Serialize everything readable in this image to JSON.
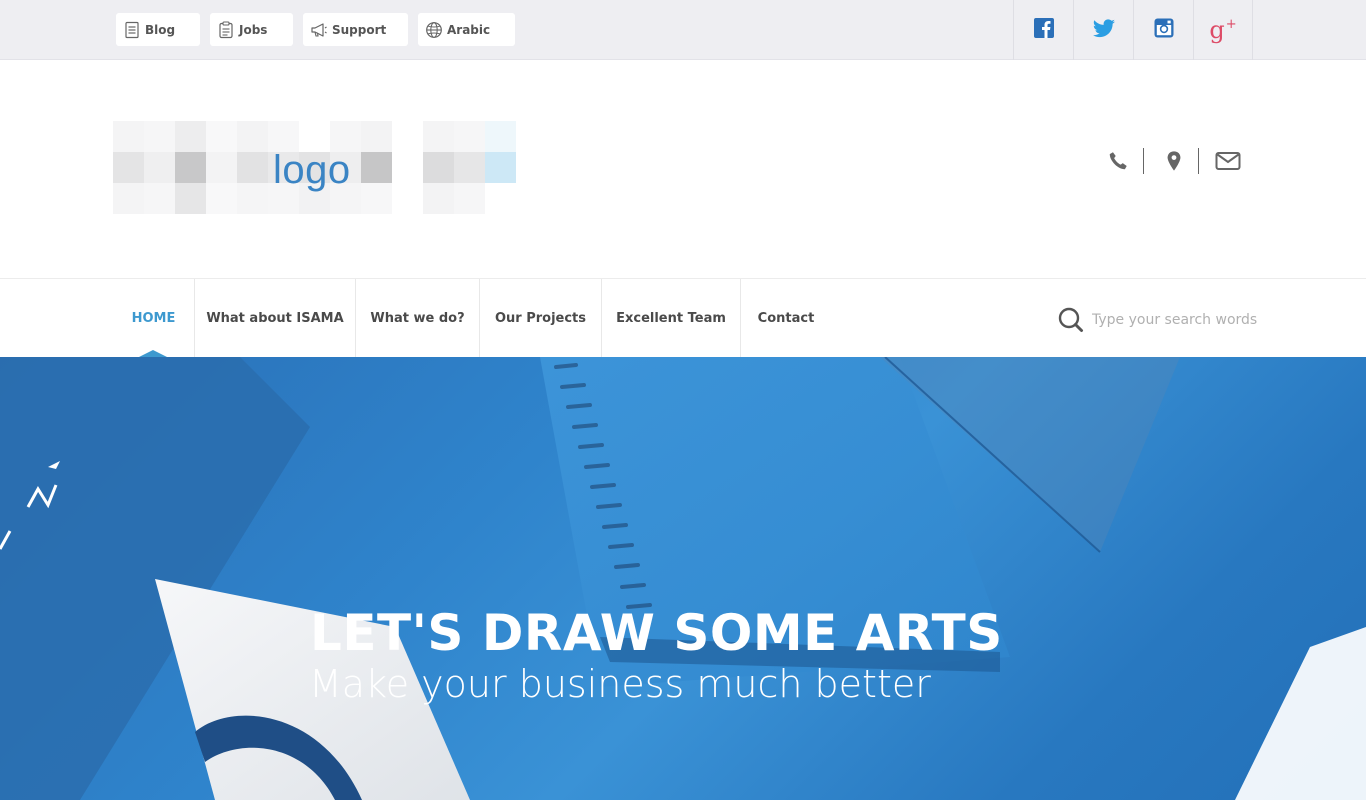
{
  "topbar": {
    "links": [
      {
        "label": "Blog",
        "icon": "document-icon"
      },
      {
        "label": "Jobs",
        "icon": "clipboard-icon"
      },
      {
        "label": "Support",
        "icon": "megaphone-icon"
      },
      {
        "label": "Arabic",
        "icon": "globe-icon"
      }
    ],
    "social": [
      {
        "name": "facebook-icon",
        "color": "#2b6fb8"
      },
      {
        "name": "twitter-icon",
        "color": "#2b9ee3"
      },
      {
        "name": "instagram-icon",
        "color": "#2b6fb8"
      },
      {
        "name": "google-plus-icon",
        "color": "#dd4b67"
      }
    ],
    "gplus_text": "g",
    "gplus_sup": "+"
  },
  "header": {
    "logo_text": "logo",
    "contact_icons": [
      "phone-icon",
      "map-marker-icon",
      "envelope-icon"
    ]
  },
  "nav": {
    "items": [
      {
        "label": "HOME",
        "active": true
      },
      {
        "label": "What about ISAMA",
        "active": false
      },
      {
        "label": "What we do?",
        "active": false
      },
      {
        "label": "Our Projects",
        "active": false
      },
      {
        "label": "Excellent Team",
        "active": false
      },
      {
        "label": "Contact",
        "active": false
      }
    ],
    "search_placeholder": "Type your search words",
    "accent": "#3d99cf"
  },
  "hero": {
    "title": "LET'S DRAW SOME ARTS",
    "subtitle": "Make your business much better",
    "background_color": "#2f84cc"
  }
}
